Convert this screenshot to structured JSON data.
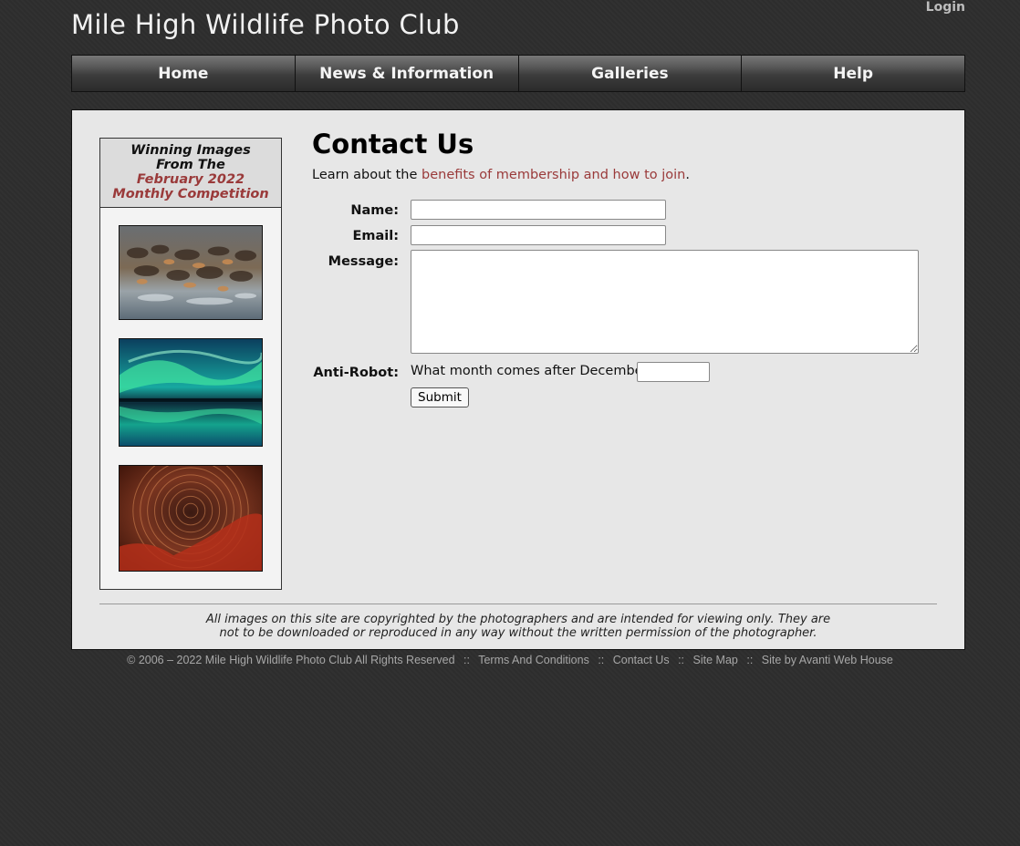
{
  "header": {
    "site_title": "Mile High Wildlife Photo Club",
    "login_label": "Login"
  },
  "nav": {
    "items": [
      {
        "label": "Home"
      },
      {
        "label": "News & Information"
      },
      {
        "label": "Galleries"
      },
      {
        "label": "Help"
      }
    ]
  },
  "sidebar": {
    "header_line1": "Winning Images",
    "header_line2": "From The",
    "header_line3": "February 2022",
    "header_line4": "Monthly Competition",
    "images": [
      {
        "subject": "wildebeest-herd-river-crossing"
      },
      {
        "subject": "aurora-borealis-reflection"
      },
      {
        "subject": "star-trails-red-rock"
      }
    ]
  },
  "content": {
    "title": "Contact Us",
    "intro_prefix": "Learn about the ",
    "intro_link": "benefits of membership and how to join",
    "intro_suffix": ".",
    "form": {
      "name_label": "Name:",
      "name_value": "",
      "email_label": "Email:",
      "email_value": "",
      "message_label": "Message:",
      "message_value": "",
      "antirobot_label": "Anti-Robot:",
      "antirobot_question": "What month comes after December?",
      "antirobot_value": "",
      "submit_label": "Submit"
    }
  },
  "disclaimer": {
    "line1": "All images on this site are copyrighted by the photographers and are intended for viewing only. They are",
    "line2": "not to be downloaded or reproduced in any way without the written permission of the photographer."
  },
  "footer": {
    "copyright": "© 2006 – 2022 Mile High Wildlife Photo Club All Rights Reserved",
    "separator": "::",
    "links": [
      "Terms And Conditions",
      "Contact Us",
      "Site Map",
      "Site by Avanti Web House"
    ]
  },
  "colors": {
    "background": "#2e2e2e",
    "panel": "#e7e7e7",
    "accent_red": "#9a3a3a",
    "nav_text": "#f4f4f4"
  }
}
